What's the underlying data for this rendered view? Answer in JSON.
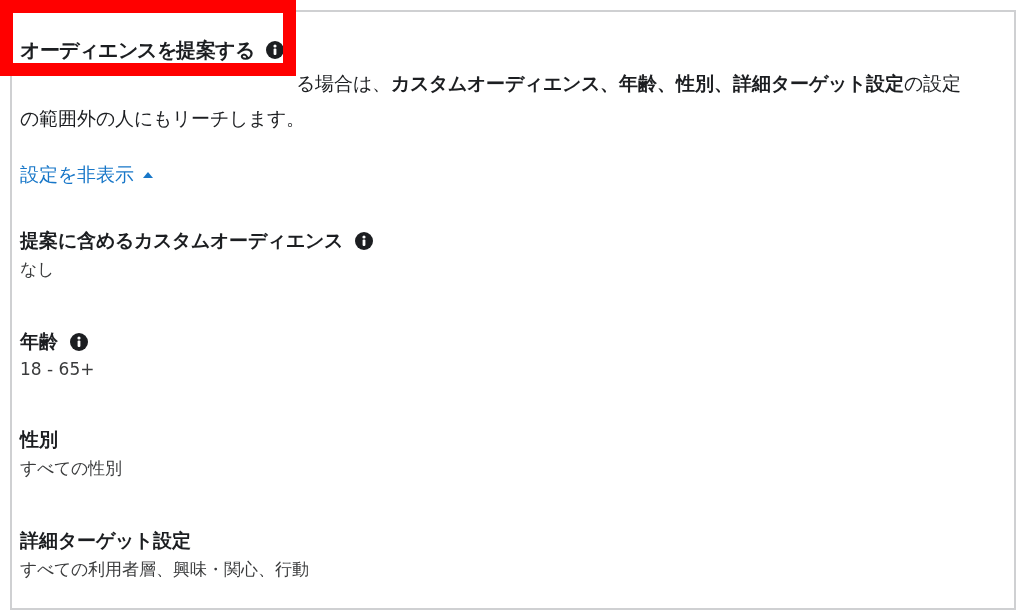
{
  "highlight": true,
  "title": "オーディエンスを提案する",
  "title_info": true,
  "description_lines": [
    "る場合は、**カスタムオーディエンス、年齢、性別、詳細ターゲット設定**の設定",
    "の範囲外の人にもリーチします。"
  ],
  "toggle": {
    "label": "設定を非表示",
    "expanded": true
  },
  "fields": [
    {
      "label": "提案に含めるカスタムオーディエンス",
      "info": true,
      "value": "なし"
    },
    {
      "label": "年齢",
      "info": true,
      "value": "18 - 65+"
    },
    {
      "label": "性別",
      "info": false,
      "value": "すべての性別"
    },
    {
      "label": "詳細ターゲット設定",
      "info": false,
      "value": "すべての利用者層、興味・関心、行動"
    }
  ]
}
